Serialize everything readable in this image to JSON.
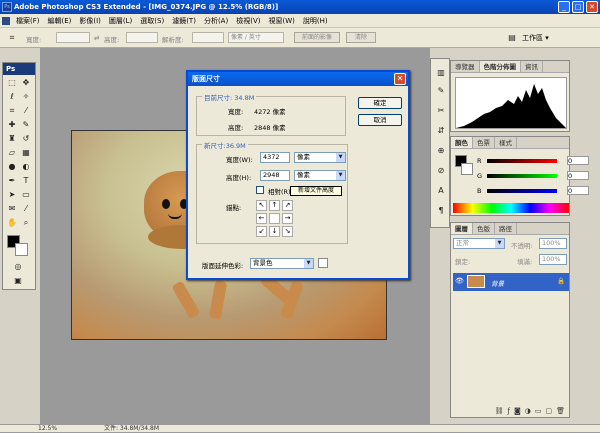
{
  "window": {
    "title": "Adobe Photoshop CS3 Extended - [IMG_0374.JPG @ 12.5% (RGB/8)]"
  },
  "menu": [
    "檔案(F)",
    "編輯(E)",
    "影像(I)",
    "圖層(L)",
    "選取(S)",
    "濾鏡(T)",
    "分析(A)",
    "檢視(V)",
    "視窗(W)",
    "說明(H)"
  ],
  "options": {
    "width_label": "寬度:",
    "height_label": "高度:",
    "resolution_label": "解析度:",
    "unit_value": "像素 / 英寸",
    "front_image_btn": "前面的影像",
    "clear_btn": "清除",
    "workspace_label": "工作區 ▾"
  },
  "toolbox": {
    "badge": "Ps"
  },
  "status": {
    "zoom": "12.5%",
    "doc": "文件: 34.8M/34.8M"
  },
  "dialog": {
    "title": "版面尺寸",
    "current_size_label": "目前尺寸: 34.8M",
    "current_width_label": "寬度:",
    "current_width_value": "4272 像素",
    "current_height_label": "高度:",
    "current_height_value": "2848 像素",
    "new_size_label": "新尺寸:36.9M",
    "new_width_label": "寬度(W):",
    "new_width_value": "4372",
    "new_width_unit": "像素",
    "new_height_label": "高度(H):",
    "new_height_value": "2948",
    "new_height_unit": "像素",
    "relative_label": "相對(R)",
    "anchor_label": "錨點:",
    "ok_btn": "確定",
    "cancel_btn": "取消",
    "ext_color_label": "版面延伸色彩:",
    "ext_color_value": "背景色",
    "tooltip": "新增文件高度"
  },
  "panels": {
    "nav_tabs": [
      "導覽器",
      "色階分佈圖",
      "資訊"
    ],
    "color_tabs": [
      "顏色",
      "色票",
      "樣式"
    ],
    "layers_tabs": [
      "圖層",
      "色版",
      "路徑"
    ],
    "blend_mode": "正常",
    "opacity_label": "不透明:",
    "opacity_value": "100%",
    "lock_label": "鎖定:",
    "fill_label": "填滿:",
    "fill_value": "100%",
    "layer_name": "背景",
    "rgb_values": [
      "0",
      "0",
      "0"
    ],
    "rgb_labels": [
      "R",
      "G",
      "B"
    ]
  },
  "colors": {
    "titlebar": "#0842b0",
    "dialog_accent": "#3060c0",
    "layer_selected": "#3264c8"
  }
}
